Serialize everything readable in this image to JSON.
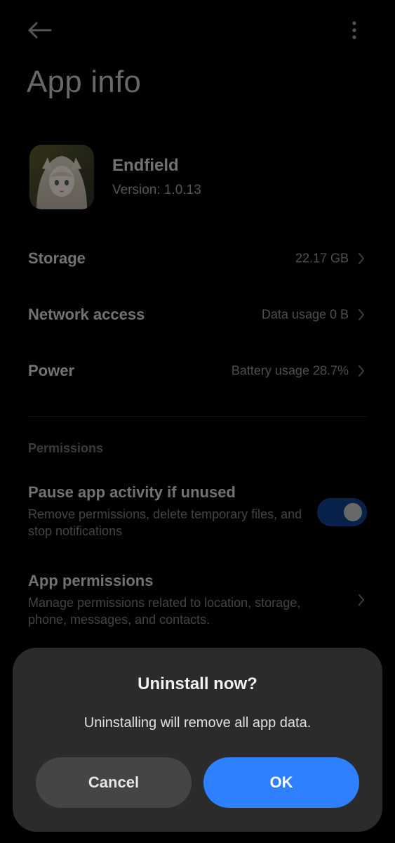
{
  "colors": {
    "background": "#000000",
    "dialog_bg": "#2b2b2b",
    "ok_button": "#2f80ff",
    "cancel_button": "#454545",
    "toggle_on": "#0d3c87"
  },
  "topbar": {
    "back_icon": "back-arrow-icon",
    "more_icon": "more-vert-icon"
  },
  "page": {
    "title": "App info"
  },
  "app": {
    "name": "Endfield",
    "version": "Version: 1.0.13",
    "icon": "app-icon-endfield"
  },
  "rows": [
    {
      "label": "Storage",
      "value": "22.17 GB"
    },
    {
      "label": "Network access",
      "value": "Data usage 0 B"
    },
    {
      "label": "Power",
      "value": "Battery usage 28.7%"
    }
  ],
  "permissions": {
    "section_title": "Permissions",
    "pause_title": "Pause app activity if unused",
    "pause_desc": "Remove permissions, delete temporary files, and stop notifications",
    "pause_enabled": true,
    "perm_title": "App permissions",
    "perm_desc": "Manage permissions related to location, storage, phone, messages, and contacts."
  },
  "dialog": {
    "title": "Uninstall now?",
    "message": "Uninstalling will remove all app data.",
    "cancel_label": "Cancel",
    "ok_label": "OK"
  }
}
